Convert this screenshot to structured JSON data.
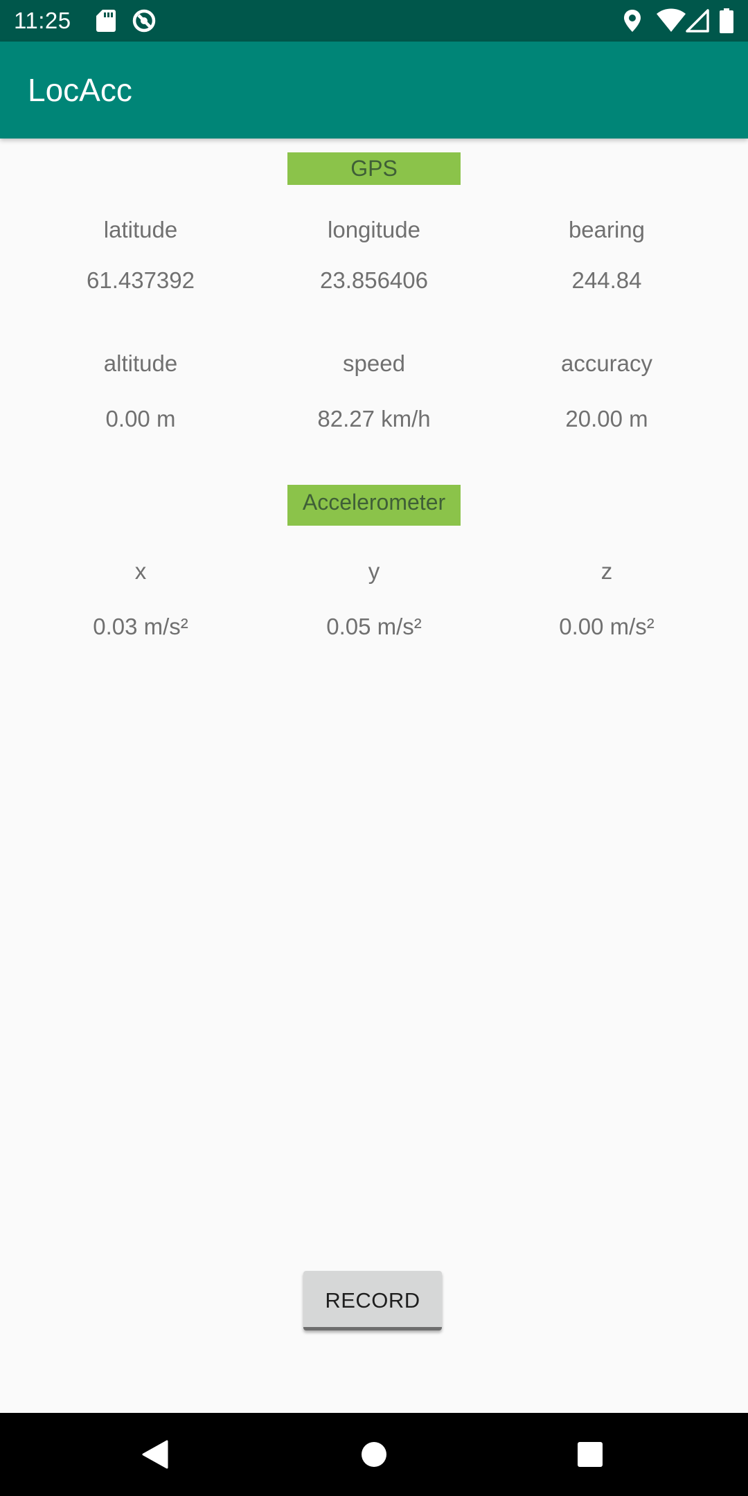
{
  "status_bar": {
    "time": "11:25",
    "left_icons": [
      "sd-card-icon",
      "app-notification-icon"
    ],
    "right_icons": [
      "location-icon",
      "wifi-icon",
      "cellular-signal-icon",
      "battery-icon"
    ]
  },
  "app_bar": {
    "title": "LocAcc",
    "color": "#008577",
    "status_color": "#00574b"
  },
  "gps": {
    "header": "GPS",
    "header_color": "#8bc34a",
    "latitude": {
      "label": "latitude",
      "value": "61.437392"
    },
    "longitude": {
      "label": "longitude",
      "value": "23.856406"
    },
    "bearing": {
      "label": "bearing",
      "value": "244.84"
    },
    "altitude": {
      "label": "altitude",
      "value": "0.00 m"
    },
    "speed": {
      "label": "speed",
      "value": "82.27 km/h"
    },
    "accuracy": {
      "label": "accuracy",
      "value": "20.00 m"
    }
  },
  "accelerometer": {
    "header": "Accelerometer",
    "x": {
      "label": "x",
      "value": "0.03 m/s²"
    },
    "y": {
      "label": "y",
      "value": "0.05 m/s²"
    },
    "z": {
      "label": "z",
      "value": "0.00 m/s²"
    }
  },
  "record_button": {
    "label": "RECORD"
  },
  "nav_bar": {
    "buttons": [
      "back-icon",
      "home-icon",
      "recents-icon"
    ]
  }
}
